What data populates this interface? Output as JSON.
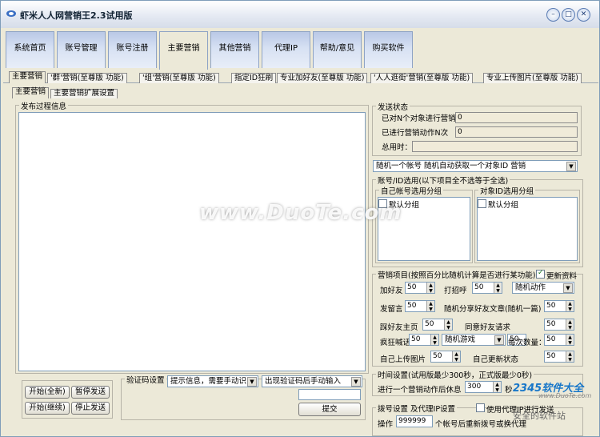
{
  "window": {
    "title": "虾米人人网营销王2.3试用版",
    "controls": {
      "minimize": "–",
      "maximize": "□",
      "close": "✕"
    }
  },
  "main_tabs": [
    "系统首页",
    "账号管理",
    "账号注册",
    "主要营销",
    "其他营销",
    "代理IP",
    "帮助/意见",
    "购买软件"
  ],
  "sub_tabs": [
    "主要营销",
    "'群'营销(至尊版 功能)",
    "'组'营销(至尊版 功能)",
    "指定ID狂刷",
    "专业加好友(至尊版 功能)",
    "'人人逛街'营销(至尊版 功能)",
    "专业上传图片(至尊版 功能)"
  ],
  "inner_tabs": [
    "主要营销",
    "主要营销扩展设置"
  ],
  "log_panel": {
    "title": "发布过程信息"
  },
  "buttons": {
    "start_new": "开始(全新)",
    "pause": "暂停发送",
    "start_continue": "开始(继续)",
    "stop": "停止发送",
    "submit": "提交"
  },
  "captcha": {
    "label": "验证码设置",
    "mode": "提示信息，需要手动识",
    "mode2": "出现验证码后手动输入"
  },
  "send_status": {
    "title": "发送状态",
    "targets_label": "已对N个对象进行营销",
    "targets_value": "0",
    "actions_label": "已进行营销动作N次",
    "actions_value": "0",
    "time_label": "总用时：",
    "time_value": ""
  },
  "account_select": "随机一个帐号    随机自动获取一个对象ID 营销",
  "groups": {
    "title": "账号/ID选用(以下项目全不选等于全选)",
    "own_title": "自己帐号选用分组",
    "own_item": "默认分组",
    "target_title": "对象ID选用分组",
    "target_item": "默认分组"
  },
  "marketing": {
    "title": "营销项目(按照百分比随机计算是否进行某功能)",
    "update_label": "更新资料",
    "update_checked": true,
    "add_friend_label": "加好友",
    "add_friend_value": "50",
    "greet_label": "打招呼",
    "greet_value": "50",
    "random_action": "随机动作",
    "random_action_value": "",
    "leave_msg_label": "发留言",
    "leave_msg_value": "50",
    "share_label": "随机分享好友文章(随机一篇)",
    "share_value": "50",
    "visit_label": "踩好友主页",
    "visit_value": "50",
    "accept_label": "同意好友请求",
    "accept_value": "50",
    "shout_label": "疯狂喊话",
    "shout_value": "50",
    "random_game": "随机游戏",
    "random_game_value": "50",
    "per_count_label": "每次数量：",
    "per_count_value": "50",
    "upload_label": "自己上传图片",
    "upload_value": "50",
    "status_label": "自己更新状态",
    "status_value": "50"
  },
  "time_settings": {
    "title": "时间设置(试用版最少300秒，正式版最少0秒)",
    "rest_label": "进行一个营销动作后休息",
    "rest_value": "300",
    "unit": "秒"
  },
  "dial": {
    "title": "拨号设置 及代理IP设置",
    "proxy_label": "使用代理IP进行发送",
    "op_label": "操作",
    "op_value": "999999",
    "op_suffix": "个帐号后重新拨号或换代理"
  },
  "watermark": "www.DuoTe.com",
  "brand": {
    "name": "2345软件大全",
    "url": "www.DuoTe.com",
    "slogan": "安全的软件站"
  }
}
